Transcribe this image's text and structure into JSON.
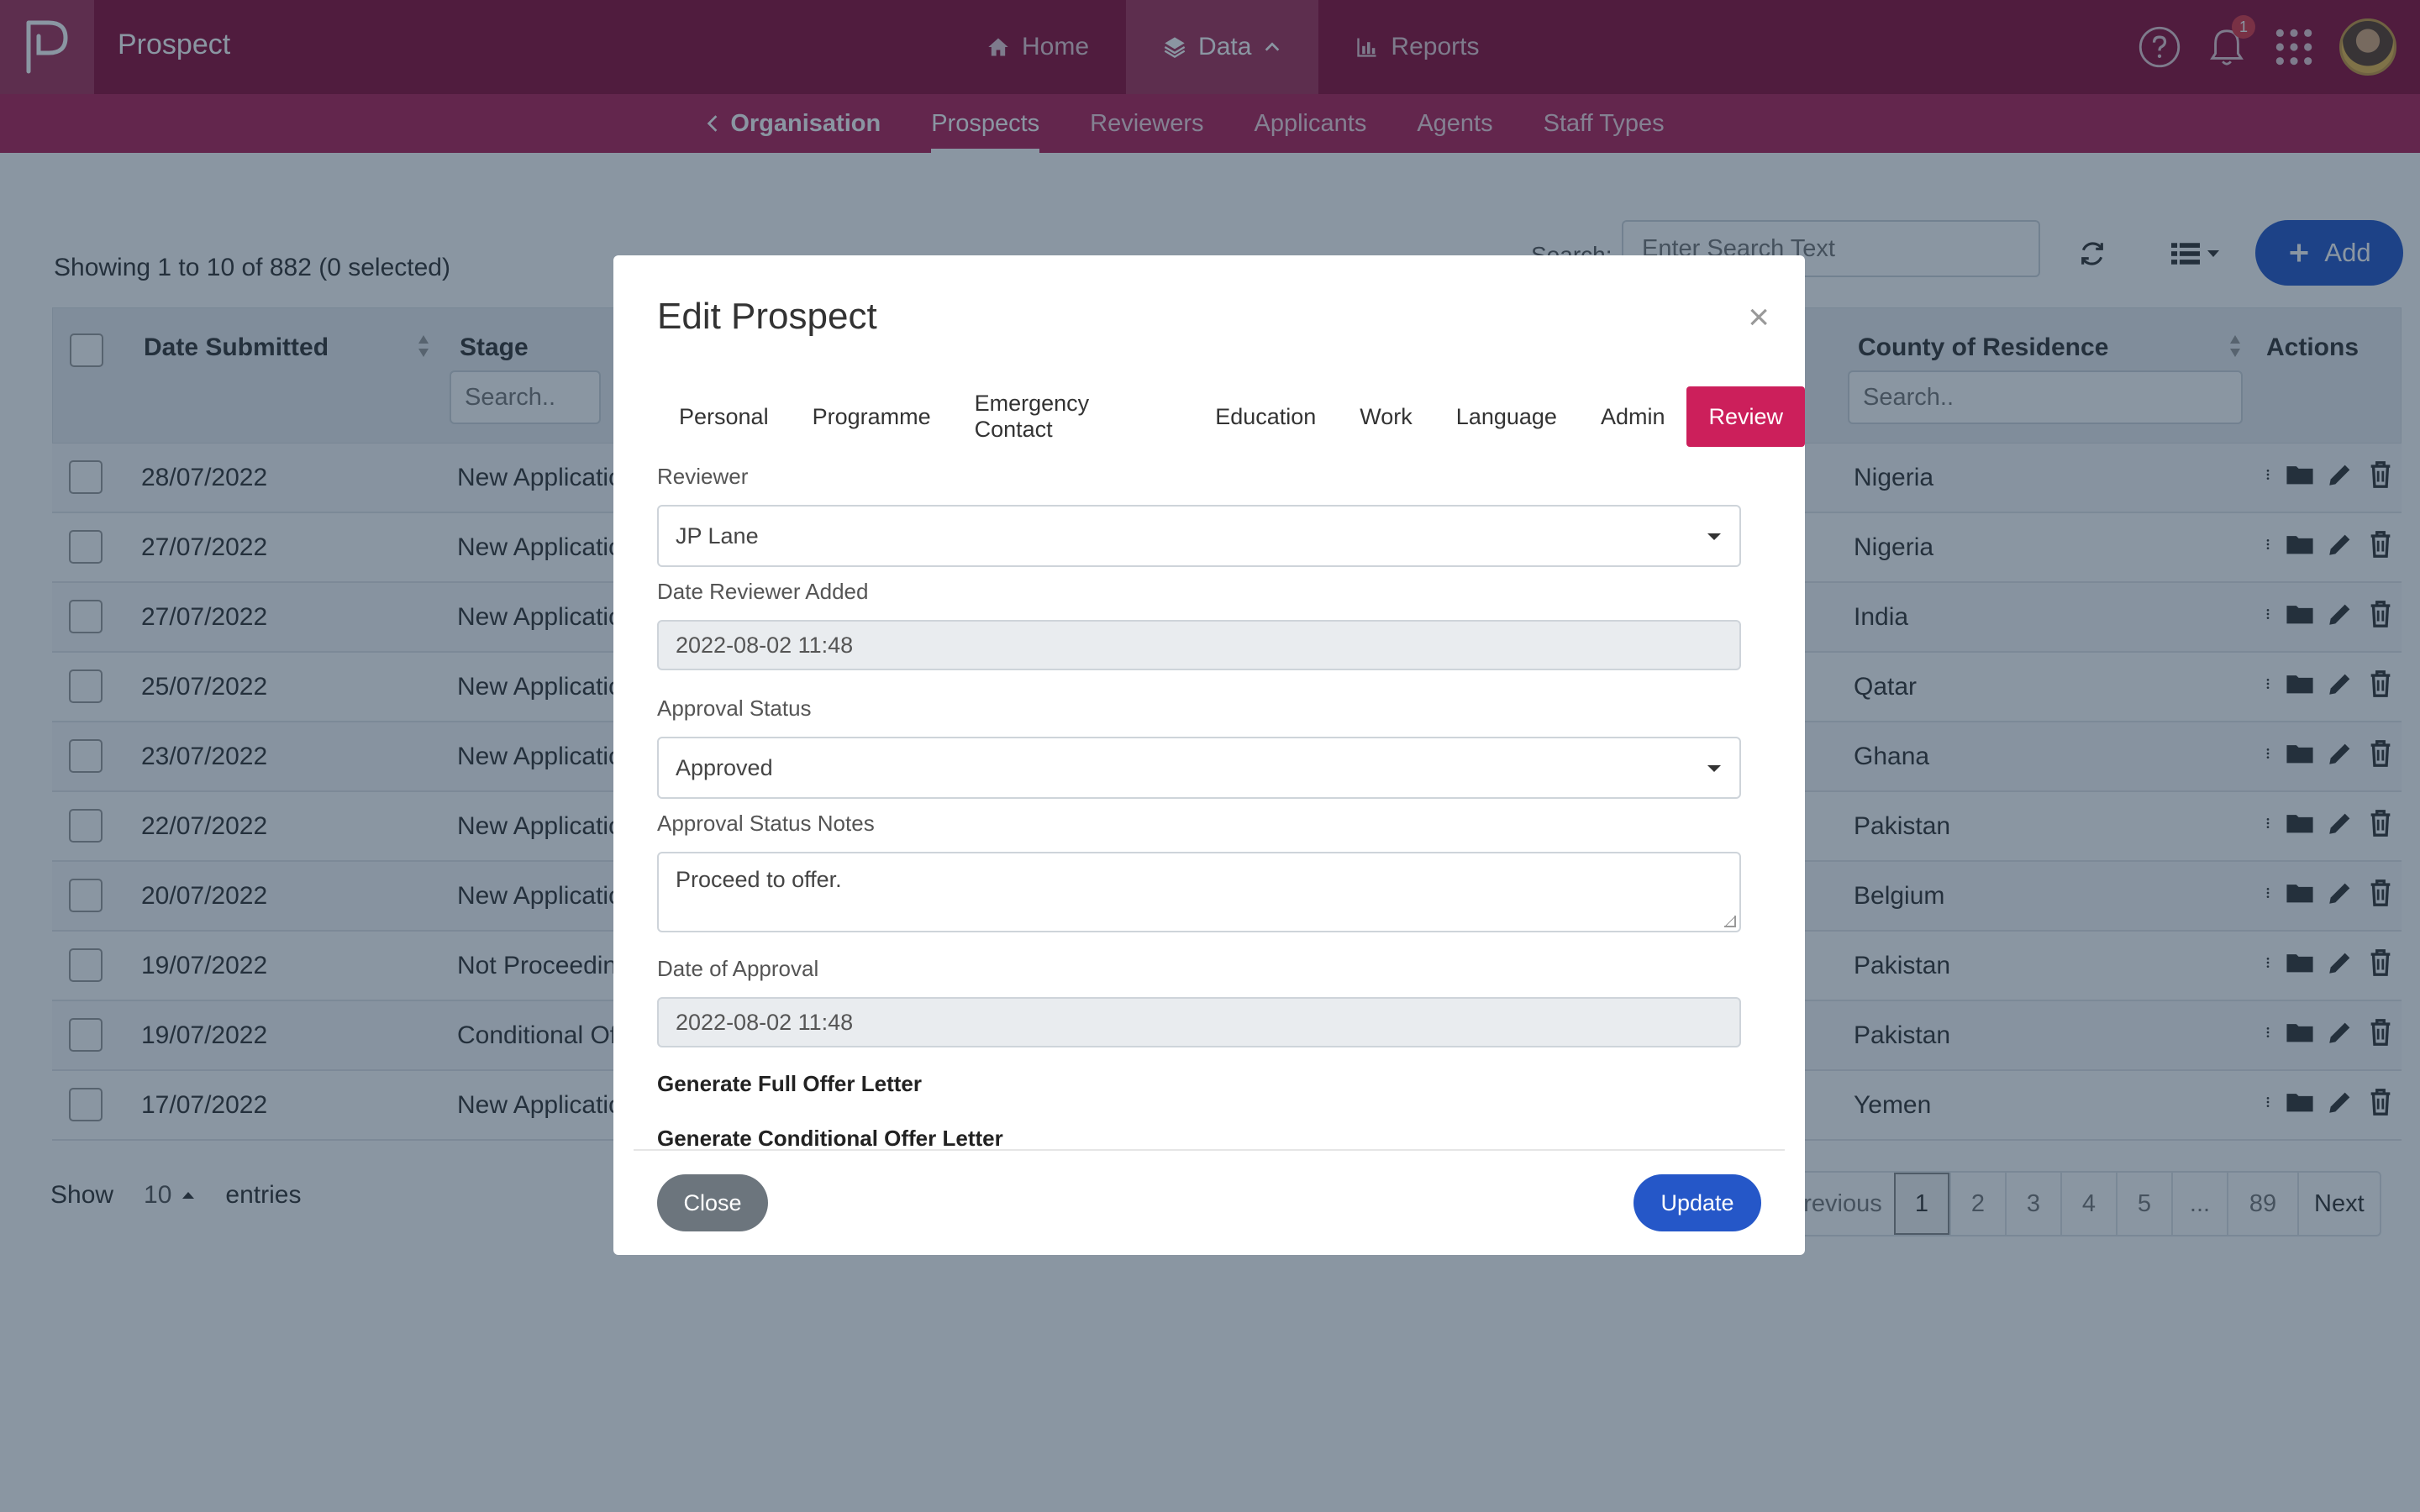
{
  "app": {
    "title": "Prospect"
  },
  "main_nav": [
    {
      "label": "Home",
      "icon": "home-icon"
    },
    {
      "label": "Data",
      "icon": "layers-icon",
      "active": true
    },
    {
      "label": "Reports",
      "icon": "bar-chart-icon"
    }
  ],
  "notifications": {
    "count": "1"
  },
  "sub_nav": {
    "back_label": "Organisation",
    "items": [
      "Prospects",
      "Reviewers",
      "Applicants",
      "Agents",
      "Staff Types"
    ],
    "active": "Prospects"
  },
  "toolbar": {
    "showing": "Showing 1 to 10 of 882 (0 selected)",
    "search_label": "Search:",
    "search_placeholder": "Enter Search Text",
    "add_label": "Add"
  },
  "table": {
    "headers": {
      "date_submitted": "Date Submitted",
      "stage": "Stage",
      "county": "County of Residence",
      "actions": "Actions"
    },
    "filter_placeholder": "Search..",
    "rows": [
      {
        "date": "28/07/2022",
        "stage": "New Applicatio",
        "county": "Nigeria"
      },
      {
        "date": "27/07/2022",
        "stage": "New Applicatio",
        "county": "Nigeria"
      },
      {
        "date": "27/07/2022",
        "stage": "New Applicatio",
        "county": "India"
      },
      {
        "date": "25/07/2022",
        "stage": "New Applicatio",
        "county": "Qatar"
      },
      {
        "date": "23/07/2022",
        "stage": "New Applicatio",
        "county": "Ghana"
      },
      {
        "date": "22/07/2022",
        "stage": "New Applicatio",
        "county": "Pakistan"
      },
      {
        "date": "20/07/2022",
        "stage": "New Applicatio",
        "county": "Belgium"
      },
      {
        "date": "19/07/2022",
        "stage": "Not Proceedin",
        "county": "Pakistan"
      },
      {
        "date": "19/07/2022",
        "stage": "Conditional Of",
        "county": "Pakistan"
      },
      {
        "date": "17/07/2022",
        "stage": "New Applicatio",
        "county": "Yemen"
      }
    ]
  },
  "footer": {
    "show": "Show",
    "page_size": "10",
    "entries": "entries",
    "pagination": [
      "revious",
      "1",
      "2",
      "3",
      "4",
      "5",
      "...",
      "89",
      "Next"
    ]
  },
  "modal": {
    "title": "Edit Prospect",
    "tabs": [
      "Personal",
      "Programme",
      "Emergency Contact",
      "Education",
      "Work",
      "Language",
      "Admin",
      "Review"
    ],
    "active_tab": "Review",
    "reviewer_label": "Reviewer",
    "reviewer_value": "JP Lane",
    "date_reviewer_added_label": "Date Reviewer Added",
    "date_reviewer_added_value": "2022-08-02 11:48",
    "approval_status_label": "Approval Status",
    "approval_status_value": "Approved",
    "approval_notes_label": "Approval Status Notes",
    "approval_notes_value": "Proceed to offer.",
    "date_of_approval_label": "Date of Approval",
    "date_of_approval_value": "2022-08-02 11:48",
    "gen_full_offer": "Generate Full Offer Letter",
    "gen_conditional_offer": "Generate Conditional Offer Letter",
    "close_label": "Close",
    "update_label": "Update"
  },
  "colors": {
    "brand": "#8b0a36",
    "subnav": "#b01e55",
    "accent_tab": "#cc1f5b",
    "primary_button": "#2557c8"
  }
}
